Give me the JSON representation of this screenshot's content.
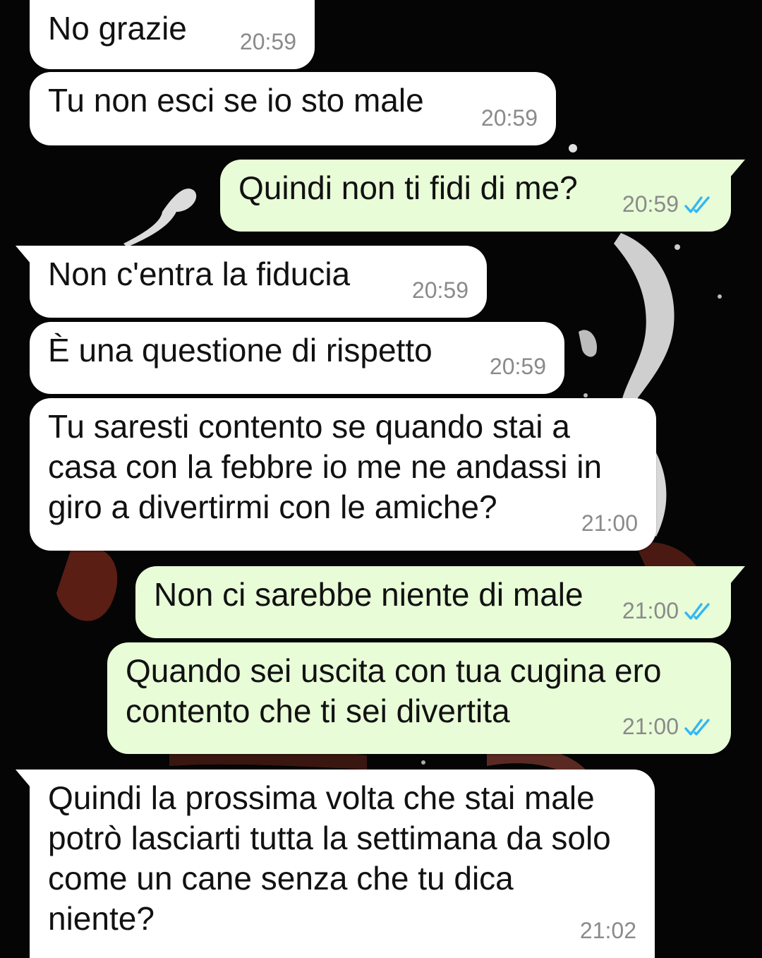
{
  "colors": {
    "incoming_bubble": "#ffffff",
    "outgoing_bubble": "#e8fcd7",
    "timestamp": "#8a8a8a",
    "read_ticks": "#34b7f1",
    "wallpaper": "#050505"
  },
  "icons": {
    "read_receipt": "double-check-read-icon"
  },
  "messages": [
    {
      "direction": "incoming",
      "text": "No grazie",
      "time": "20:59"
    },
    {
      "direction": "incoming",
      "text": "Tu non esci se io sto male",
      "time": "20:59"
    },
    {
      "direction": "outgoing",
      "text": "Quindi non ti fidi di me?",
      "time": "20:59",
      "status": "read"
    },
    {
      "direction": "incoming",
      "text": "Non c'entra la fiducia",
      "time": "20:59"
    },
    {
      "direction": "incoming",
      "text": "È una questione di rispetto",
      "time": "20:59"
    },
    {
      "direction": "incoming",
      "text": "Tu saresti contento se quando stai a casa con la febbre io me ne andassi in giro a divertirmi con le amiche?",
      "time": "21:00"
    },
    {
      "direction": "outgoing",
      "text": "Non ci sarebbe niente di male",
      "time": "21:00",
      "status": "read"
    },
    {
      "direction": "outgoing",
      "text": "Quando sei uscita con tua cugina ero contento che ti sei divertita",
      "time": "21:00",
      "status": "read"
    },
    {
      "direction": "incoming",
      "text": "Quindi la prossima volta che stai male potrò lasciarti tutta la settimana da solo come un cane senza che tu dica niente?",
      "time": "21:02"
    }
  ]
}
